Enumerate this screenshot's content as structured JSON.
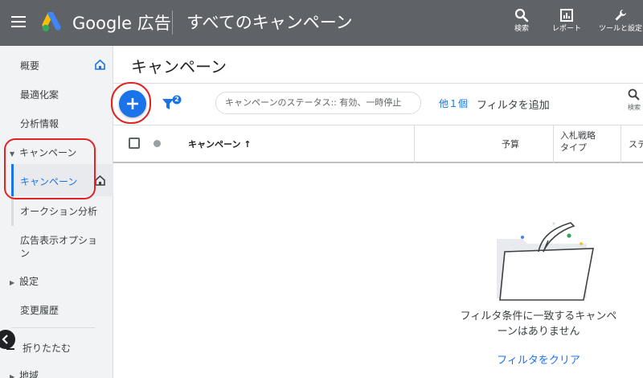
{
  "header": {
    "brand": "Google 広告",
    "page_heading": "すべてのキャンペーン",
    "actions": [
      {
        "label": "検索",
        "icon": "search-icon"
      },
      {
        "label": "レポート",
        "icon": "report-icon"
      },
      {
        "label": "ツールと設定",
        "icon": "wrench-icon"
      }
    ]
  },
  "sidebar": {
    "items": [
      {
        "label": "概要"
      },
      {
        "label": "最適化案"
      },
      {
        "label": "分析情報"
      },
      {
        "label": "キャンペーン"
      },
      {
        "label": "キャンペーン"
      },
      {
        "label": "オークション分析"
      },
      {
        "label": "広告表示オプション"
      },
      {
        "label": "設定"
      },
      {
        "label": "変更履歴"
      },
      {
        "label": "折りたたむ"
      },
      {
        "label": "地域"
      }
    ]
  },
  "main": {
    "title": "キャンペーン",
    "filter_badge": "2",
    "filter_chip": "キャンペーンのステータス:: 有効、一時停止",
    "more_count": "他１個",
    "add_filter": "フィルタを追加",
    "search_label": "検索",
    "columns": {
      "campaign": "キャンペーン ↑",
      "budget": "予算",
      "bid_line1": "入札戦略",
      "bid_line2": "タイプ",
      "status": "ステ"
    },
    "empty_message_line1": "フィルタ条件に一致するキャンペ",
    "empty_message_line2": "ーンはありません",
    "clear_filter": "フィルタをクリア"
  },
  "colors": {
    "header_bg": "#5f6368",
    "accent": "#1a73e8",
    "annotation": "#e02424"
  }
}
